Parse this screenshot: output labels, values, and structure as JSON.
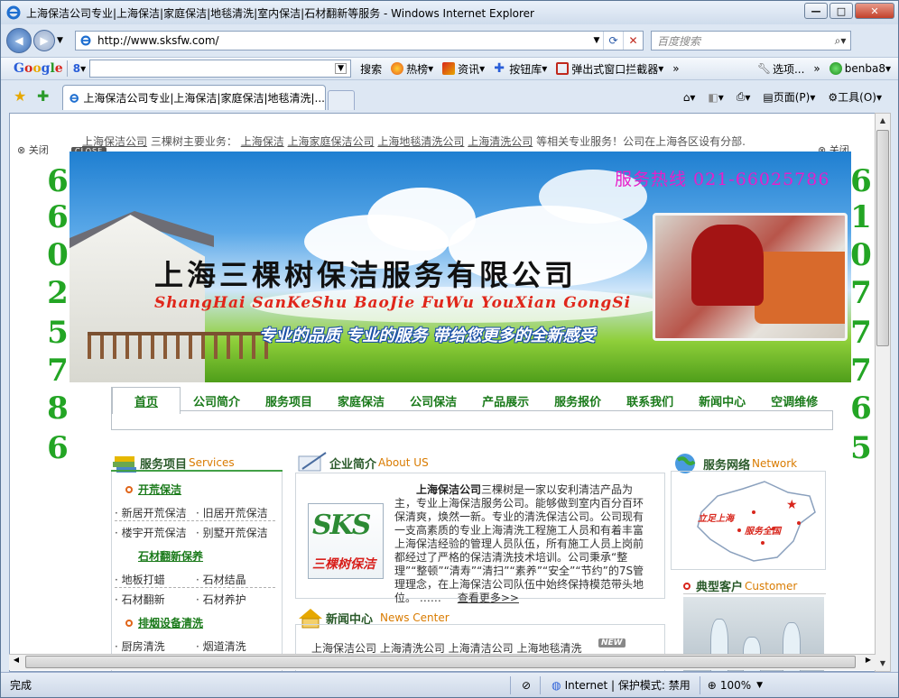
{
  "window": {
    "title": "上海保洁公司专业|上海保洁|家庭保洁|地毯清洗|室内保洁|石材翻新等服务 - Windows Internet Explorer"
  },
  "address": {
    "url": "http://www.sksfw.com/",
    "search_placeholder": "百度搜索"
  },
  "googlebar": {
    "logo": "Google",
    "g_label": "8",
    "search_label": "搜索",
    "items": [
      {
        "label": "热榜",
        "icon": "fire-icon"
      },
      {
        "label": "资讯",
        "icon": "news-icon"
      },
      {
        "label": "按钮库",
        "icon": "plus-icon"
      },
      {
        "label": "弹出式窗口拦截器",
        "icon": "block-icon"
      }
    ],
    "options_label": "选项...",
    "user_label": "benba8"
  },
  "tab": {
    "label": "上海保洁公司专业|上海保洁|家庭保洁|地毯清洗|..."
  },
  "commandbar": {
    "page_label": "页面(P)",
    "tools_label": "工具(O)"
  },
  "page": {
    "marquee": {
      "link1": "上海保洁公司",
      "text1": "三棵树主要业务：",
      "link2": "上海保洁",
      "link3": "上海家庭保洁公司",
      "link4": "上海地毯清洗公司",
      "link5": "上海清洗公司",
      "text2": "等相关专业服务！公司在上海各区设有分部."
    },
    "close_label": "关闭",
    "close_badge": "CLOSE",
    "left_digits": [
      "6",
      "6",
      "0",
      "2",
      "5",
      "7",
      "8",
      "6"
    ],
    "right_digits": [
      "6",
      "1",
      "0",
      "7",
      "7",
      "7",
      "6",
      "5"
    ],
    "banner": {
      "hotline": "服务热线 021-66025786",
      "company_name": "上海三棵树保洁服务有限公司",
      "pinyin": "ShangHai SanKeShu BaoJie FuWu YouXian GongSi",
      "slogan": "专业的品质 专业的服务 带给您更多的全新感受"
    },
    "nav": [
      "首页",
      "公司简介",
      "服务项目",
      "家庭保洁",
      "公司保洁",
      "产品展示",
      "服务报价",
      "联系我们",
      "新闻中心",
      "空调维修"
    ],
    "services": {
      "title_cn": "服务项目",
      "title_en": "Services",
      "groups": [
        {
          "name": "开荒保洁",
          "items": [
            "新居开荒保洁",
            "旧居开荒保洁",
            "楼宇开荒保洁",
            "别墅开荒保洁"
          ]
        },
        {
          "name": "石材翻新保养",
          "items": [
            "地板打蜡",
            "石材结晶",
            "石材翻新",
            "石材养护"
          ]
        },
        {
          "name": "排烟设备清洗",
          "items": [
            "厨房清洗",
            "烟道清洗"
          ]
        }
      ]
    },
    "about": {
      "title_cn": "企业简介",
      "title_en": "About US",
      "logo_text": "SKS",
      "logo_sub": "三棵树保洁",
      "lead_bold": "上海保洁公司",
      "body": "三棵树是一家以安利清洁产品为主，专业上海保洁服务公司。能够做到室内百分百环保清爽，焕然一新。专业的清洗保洁公司。公司现有一支高素质的专业上海清洗工程施工人员和有着丰富上海保洁经验的管理人员队伍，所有施工人员上岗前都经过了严格的保洁清洗技术培训。公司秉承“整理”“整顿”“清寿”“清扫”“素养”“安全”“节约”的7S管理理念，在上海保洁公司队伍中始终保持模范带头地位。 ……",
      "more": "查看更多>>"
    },
    "news": {
      "title_cn": "新闻中心",
      "title_en": "News Center",
      "row": "上海保洁公司 上海清洗公司 上海清洁公司 上海地毯清洗",
      "badge": "NEW"
    },
    "network": {
      "title_cn": "服务网络",
      "title_en": "Network",
      "map_label1": "立足上海",
      "map_label2": "服务全国"
    },
    "customer": {
      "title_cn": "典型客户",
      "title_en": "Customer"
    }
  },
  "status": {
    "text": "完成",
    "zone": "Internet | 保护模式: 禁用",
    "zoom": "100%"
  }
}
